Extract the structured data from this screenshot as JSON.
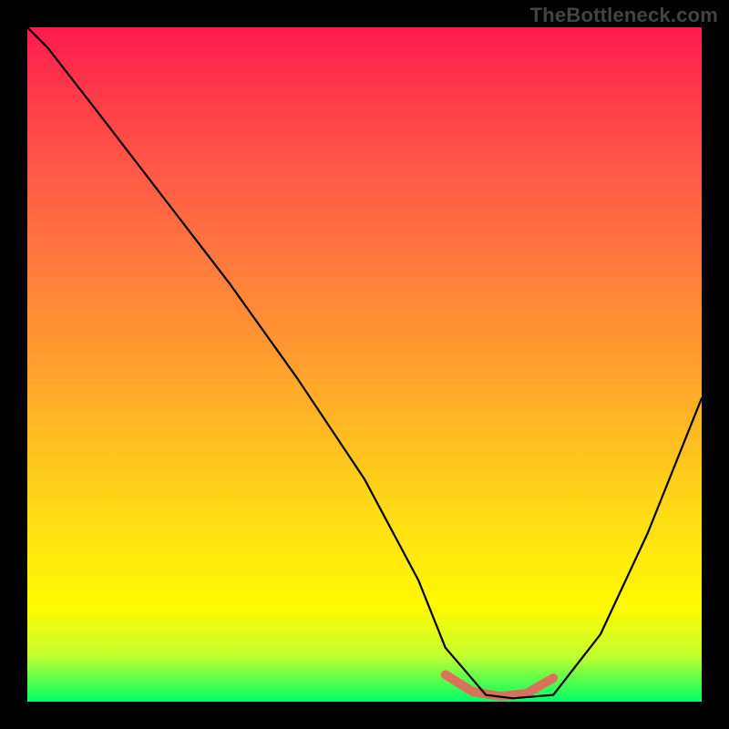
{
  "watermark": "TheBottleneck.com",
  "chart_data": {
    "type": "line",
    "title": "",
    "xlabel": "",
    "ylabel": "",
    "xlim": [
      0,
      100
    ],
    "ylim": [
      0,
      100
    ],
    "grid": false,
    "legend": false,
    "background_gradient": [
      "#ff1a4d",
      "#ff9a30",
      "#fff900",
      "#00ff66"
    ],
    "series": [
      {
        "name": "bottleneck-curve",
        "color": "#000000",
        "x": [
          0,
          3,
          10,
          20,
          30,
          40,
          50,
          58,
          62,
          68,
          72,
          78,
          85,
          92,
          100
        ],
        "values": [
          100,
          97,
          88,
          75,
          62,
          48,
          33,
          18,
          8,
          1,
          0.5,
          1,
          10,
          25,
          45
        ]
      }
    ],
    "highlight": {
      "name": "optimal-zone",
      "color": "#e26a5c",
      "x": [
        62,
        66,
        70,
        74,
        78
      ],
      "values": [
        4,
        1.5,
        0.8,
        1.2,
        3.5
      ]
    }
  }
}
